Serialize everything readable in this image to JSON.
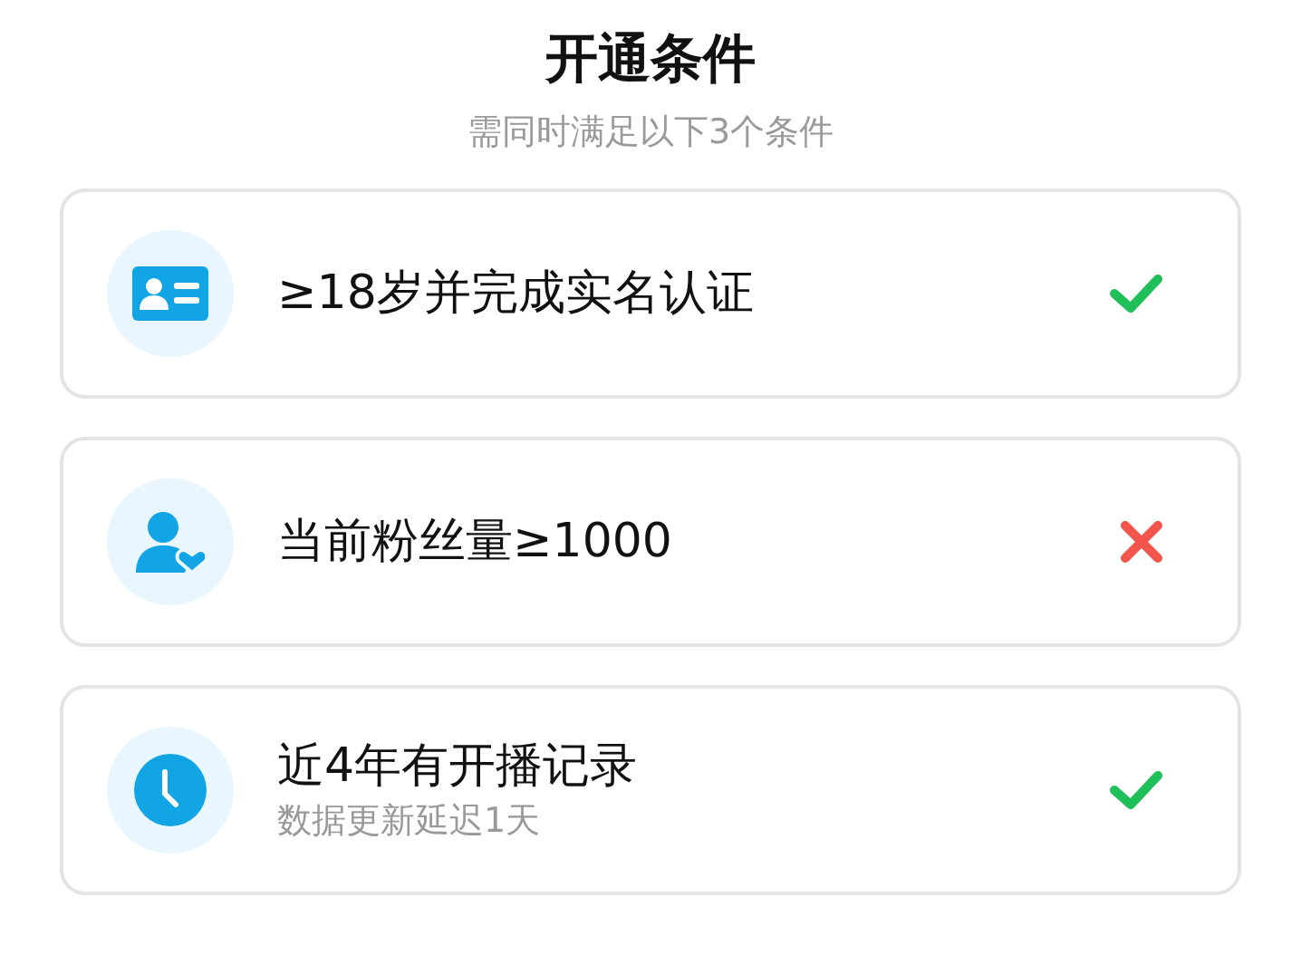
{
  "title": "开通条件",
  "subtitle": "需同时满足以下3个条件",
  "conditions": [
    {
      "kind": "id-card",
      "label": "≥18岁并完成实名认证",
      "met": true
    },
    {
      "kind": "fans",
      "label": "当前粉丝量≥1000",
      "met": false
    },
    {
      "kind": "clock",
      "label": "近4年有开播记录",
      "note": "数据更新延迟1天",
      "met": true
    }
  ]
}
